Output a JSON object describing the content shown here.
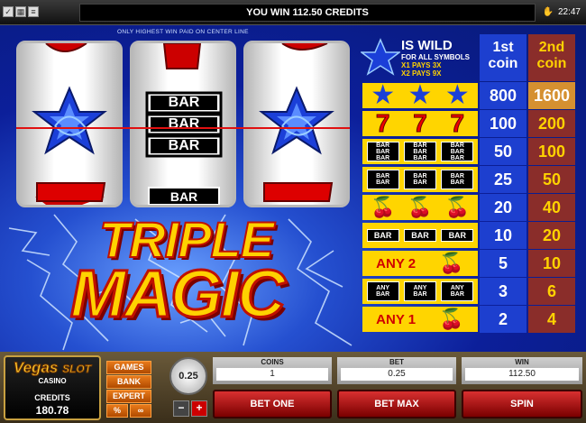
{
  "topbar": {
    "message": "YOU WIN 112.50 CREDITS",
    "clock": "22:47"
  },
  "game": {
    "centerline_note": "ONLY HIGHEST WIN PAID ON CENTER LINE",
    "title_line1": "TRIPLE",
    "title_line2": "MAGIC",
    "reels": [
      {
        "center_symbol": "star"
      },
      {
        "center_symbol": "triple-bar",
        "bar_text": "BAR"
      },
      {
        "center_symbol": "star"
      }
    ]
  },
  "paytable": {
    "wild_title": "IS WILD",
    "wild_sub1": "FOR ALL SYMBOLS",
    "wild_sub2": "X1 PAYS 3X",
    "wild_sub3": "X2 PAYS 9X",
    "col1_label": "1st coin",
    "col2_label": "2nd coin",
    "bar_text": "BAR",
    "any_text": "ANY",
    "any2_text": "ANY 2",
    "any1_text": "ANY 1",
    "rows": [
      {
        "v1": "800",
        "v2": "1600"
      },
      {
        "v1": "100",
        "v2": "200"
      },
      {
        "v1": "50",
        "v2": "100"
      },
      {
        "v1": "25",
        "v2": "50"
      },
      {
        "v1": "20",
        "v2": "40"
      },
      {
        "v1": "10",
        "v2": "20"
      },
      {
        "v1": "5",
        "v2": "10"
      },
      {
        "v1": "3",
        "v2": "6"
      },
      {
        "v1": "2",
        "v2": "4"
      }
    ],
    "colors": {
      "col1": "#1d3fcf",
      "col2": "#8a2d2a",
      "highlight": "#d59030",
      "symbol_bg": "#ffd500"
    }
  },
  "panel": {
    "logo_title": "Vegas",
    "logo_title2": "SLOT",
    "logo_sub": "CASINO",
    "credits_label": "CREDITS",
    "credits_value": "180.78",
    "menu": {
      "games": "GAMES",
      "bank": "BANK",
      "expert": "EXPERT",
      "percent": "%",
      "infinity": "∞"
    },
    "coin_value": "0.25",
    "minus_label": "−",
    "plus_label": "+",
    "coins_label": "COINS",
    "coins_value": "1",
    "bet_label": "BET",
    "bet_value": "0.25",
    "win_label": "WIN",
    "win_value": "112.50",
    "bet_one": "BET ONE",
    "bet_max": "BET MAX",
    "spin": "SPIN"
  }
}
